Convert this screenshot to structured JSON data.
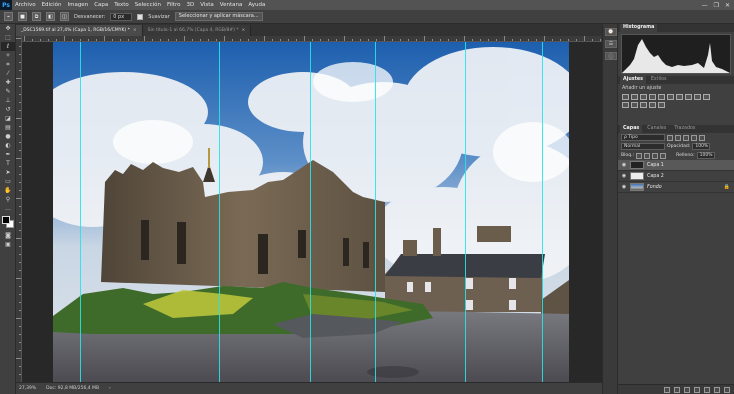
{
  "app": {
    "logo": "Ps"
  },
  "menu": [
    "Archivo",
    "Edición",
    "Imagen",
    "Capa",
    "Texto",
    "Selección",
    "Filtro",
    "3D",
    "Vista",
    "Ventana",
    "Ayuda"
  ],
  "window_controls": [
    "—",
    "❐",
    "✕"
  ],
  "options_bar": {
    "feather_label": "Desvanecer:",
    "feather_value": "0 px",
    "smooth_label": "Suavizar",
    "select_mask_button": "Seleccionar y aplicar máscara..."
  },
  "tabs": [
    {
      "label": "_DSC1569.tif al 27,4% (Capa 1, RGB/16/CMYK) *",
      "active": true
    },
    {
      "label": "Sin título-1 al 66,7% (Capa 4, RGB/8#) *",
      "active": false
    }
  ],
  "status": {
    "zoom": "27,39%",
    "doc": "Doc: 92,8 MB/256,4 MB"
  },
  "panels": {
    "histogram_tab": "Histograma",
    "adjustments_tabs": [
      "Ajustes",
      "Estilos"
    ],
    "add_adjustment": "Añadir un ajuste",
    "layer_tabs": [
      "Capas",
      "Canales",
      "Trazados"
    ],
    "kind_label": "ρ Tipo",
    "blend_mode": "Normal",
    "opacity_label": "Opacidad:",
    "opacity_value": "100%",
    "lock_label": "Bloq.:",
    "fill_label": "Relleno:",
    "fill_value": "100%",
    "layers": [
      {
        "name": "Capa 1",
        "selected": true,
        "italic": false
      },
      {
        "name": "Capa 2",
        "selected": false,
        "italic": false
      },
      {
        "name": "Fondo",
        "selected": false,
        "italic": true
      }
    ]
  },
  "colors": {
    "guide": "#27e3e8",
    "ui_bg": "#535353",
    "panel_bg": "#404040",
    "selected_layer": "#595959",
    "sky": "#2a6fbf"
  },
  "icons": {
    "tools": [
      "move-tool-icon",
      "marquee-tool-icon",
      "lasso-tool-icon",
      "magic-wand-icon",
      "crop-icon",
      "eyedropper-icon",
      "spot-heal-icon",
      "brush-icon",
      "clone-stamp-icon",
      "history-brush-icon",
      "eraser-icon",
      "gradient-icon",
      "blur-icon",
      "dodge-icon",
      "pen-icon",
      "type-icon",
      "path-select-icon",
      "rectangle-icon",
      "hand-icon",
      "zoom-icon"
    ]
  }
}
